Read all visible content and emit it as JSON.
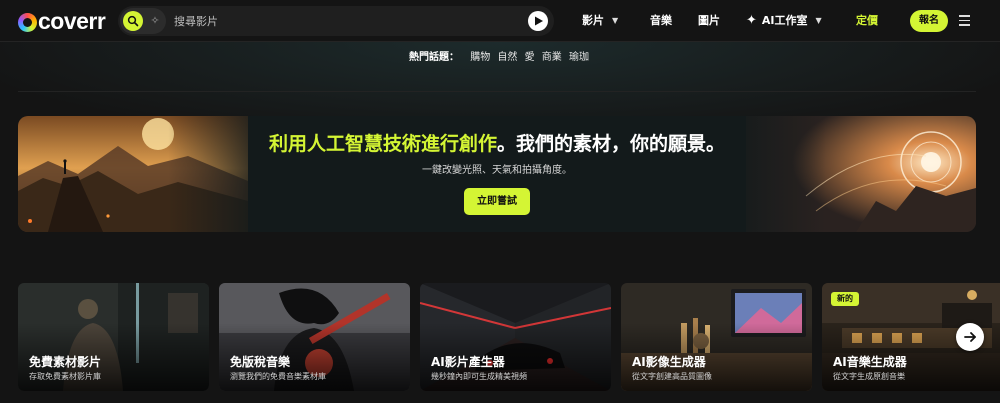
{
  "brand": {
    "name": "coverr"
  },
  "search": {
    "placeholder": "搜尋影片"
  },
  "nav": {
    "videos": "影片",
    "music": "音樂",
    "images": "圖片",
    "ai_studio": "AI工作室",
    "pricing": "定價",
    "signup": "報名"
  },
  "trending": {
    "label": "熱門話題：",
    "tags": [
      "購物",
      "自然",
      "愛",
      "商業",
      "瑜珈"
    ]
  },
  "banner": {
    "title_highlight": "利用人工智慧技術進行創作",
    "title_rest": "。我們的素材，你的願景。",
    "subtitle": "一鍵改變光照、天氣和拍攝角度。",
    "cta": "立即嘗試"
  },
  "cards": [
    {
      "title": "免費素材影片",
      "subtitle": "存取免費素材影片庫",
      "badge": ""
    },
    {
      "title": "免版稅音樂",
      "subtitle": "瀏覽我們的免費音樂素材庫",
      "badge": ""
    },
    {
      "title": "AI影片產生器",
      "subtitle": "幾秒鐘內即可生成精美視頻",
      "badge": ""
    },
    {
      "title": "AI影像生成器",
      "subtitle": "從文字創建高品質圖像",
      "badge": ""
    },
    {
      "title": "AI音樂生成器",
      "subtitle": "從文字生成原創音樂",
      "badge": "新的"
    }
  ],
  "colors": {
    "accent": "#d4f534",
    "background": "#141414"
  },
  "icons": {
    "search": "search-icon",
    "ai_mode": "sparkle-icon",
    "submit": "play-arrow-icon",
    "menu": "hamburger-icon",
    "next": "arrow-right-icon"
  }
}
